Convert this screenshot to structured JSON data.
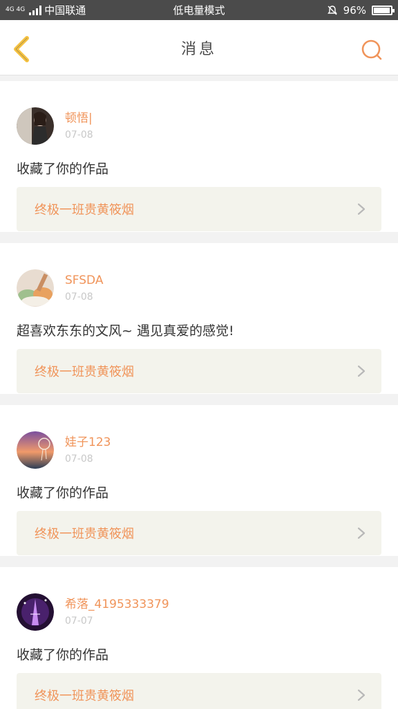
{
  "statusbar": {
    "network": "4G 4G",
    "carrier": "中国联通",
    "mode": "低电量模式",
    "battery": "96%"
  },
  "header": {
    "title": "消息",
    "back_icon": "chevron-left-icon",
    "search_icon": "search-icon"
  },
  "colors": {
    "accent": "#f0945a",
    "back_arrow": "#f5c242",
    "username": "#f0945a",
    "card_link_bg": "#f3f3ec"
  },
  "messages": [
    {
      "username": "顿悟|",
      "date": "07-08",
      "text": "收藏了你的作品",
      "work_title": "终极一班贵黄筱烟"
    },
    {
      "username": "SFSDA",
      "date": "07-08",
      "text": "超喜欢东东的文风~ 遇见真爱的感觉!",
      "work_title": "终极一班贵黄筱烟"
    },
    {
      "username": "娃子123",
      "date": "07-08",
      "text": "收藏了你的作品",
      "work_title": "终极一班贵黄筱烟"
    },
    {
      "username": "希落_4195333379",
      "date": "07-07",
      "text": "收藏了你的作品",
      "work_title": "终极一班贵黄筱烟"
    }
  ]
}
